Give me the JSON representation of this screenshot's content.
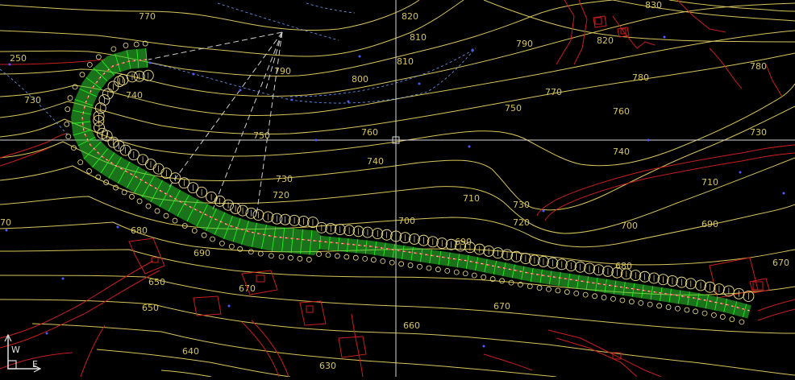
{
  "contour_labels": [
    "770",
    "780",
    "790",
    "800",
    "810",
    "820",
    "830",
    "810",
    "820",
    "780",
    "790",
    "750",
    "760",
    "770",
    "750",
    "740",
    "730",
    "720",
    "710",
    "700",
    "690",
    "680",
    "670",
    "660",
    "650",
    "640",
    "630",
    "710",
    "720",
    "730",
    "740",
    "760",
    "730",
    "740",
    "750",
    "710",
    "700",
    "690",
    "680",
    "670",
    "730",
    "250",
    "70",
    "720",
    "680",
    "690",
    "670",
    "650",
    "660",
    "640",
    "630"
  ],
  "ucs": {
    "y": "W",
    "x": "E"
  },
  "colors": {
    "background": "#000000",
    "contours": "#d7c45a",
    "parcels": "#c81e1e",
    "alignment_fill": "#2fd12f",
    "stations": "#f0e08a",
    "labels": "#4a5cff",
    "crosshair": "#d8d8d8"
  }
}
